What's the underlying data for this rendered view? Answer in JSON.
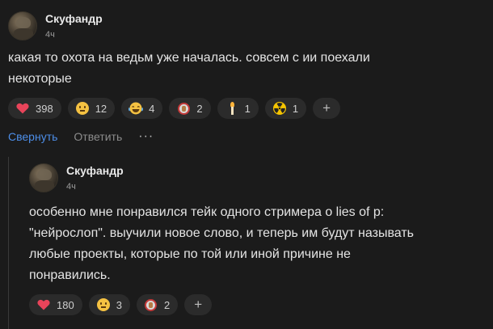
{
  "comments": [
    {
      "author": "Скуфандр",
      "time": "4ч",
      "text_lines": [
        "какая то охота на ведьм уже началась. совсем с ии поехали",
        "некоторые"
      ],
      "reactions": [
        {
          "icon": "heart-icon",
          "count": "398"
        },
        {
          "icon": "neutral-face-icon",
          "count": "12"
        },
        {
          "icon": "laughing-face-icon",
          "count": "4"
        },
        {
          "icon": "badge-icon",
          "count": "2"
        },
        {
          "icon": "torch-icon",
          "count": "1"
        },
        {
          "icon": "radioactive-icon",
          "count": "1"
        }
      ],
      "add_reaction": "+",
      "actions": {
        "collapse": "Свернуть",
        "reply": "Ответить",
        "more": "···"
      }
    },
    {
      "author": "Скуфандр",
      "time": "4ч",
      "text_lines": [
        "особенно мне понравился тейк одного стримера о lies of p:",
        "\"нейрослоп\". выучили новое слово, и теперь им будут называть",
        "любые проекты, которые по той или иной причине не",
        "понравились."
      ],
      "reactions": [
        {
          "icon": "heart-icon",
          "count": "180"
        },
        {
          "icon": "neutral-face-icon",
          "count": "3"
        },
        {
          "icon": "badge-icon",
          "count": "2"
        }
      ],
      "add_reaction": "+"
    }
  ],
  "colors": {
    "background": "#1b1b1b",
    "accent_link": "#4d8ee8",
    "heart": "#e8445a",
    "pill": "#2b2b2b"
  }
}
